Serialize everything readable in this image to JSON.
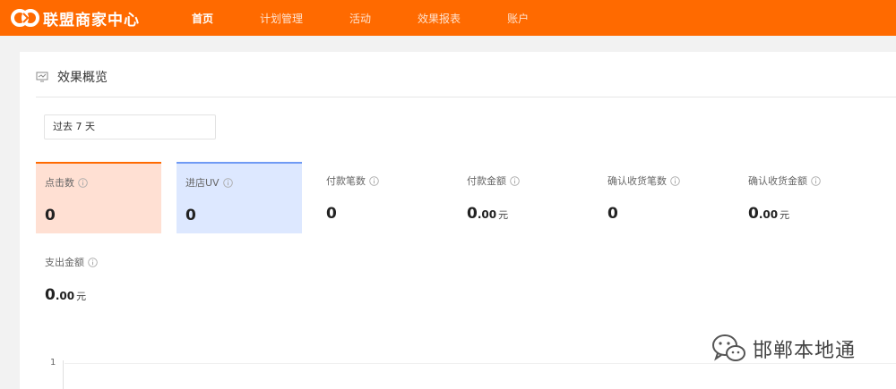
{
  "brand": {
    "name": "联盟商家中心"
  },
  "nav": [
    {
      "label": "首页",
      "active": true
    },
    {
      "label": "计划管理",
      "active": false
    },
    {
      "label": "活动",
      "active": false
    },
    {
      "label": "效果报表",
      "active": false
    },
    {
      "label": "账户",
      "active": false
    }
  ],
  "section": {
    "title": "效果概览"
  },
  "date_range": {
    "value": "过去 7 天"
  },
  "metrics": [
    {
      "label": "点击数",
      "value": "0"
    },
    {
      "label": "进店UV",
      "value": "0"
    },
    {
      "label": "付款笔数",
      "value": "0"
    },
    {
      "label": "付款金额",
      "int": "0",
      "dec": ".00",
      "unit": "元"
    },
    {
      "label": "确认收货笔数",
      "value": "0"
    },
    {
      "label": "确认收货金额",
      "int": "0",
      "dec": ".00",
      "unit": "元"
    },
    {
      "label": "支出金额",
      "int": "0",
      "dec": ".00",
      "unit": "元"
    }
  ],
  "chart": {
    "y_tick": "1"
  },
  "watermark": {
    "text": "邯郸本地通"
  },
  "colors": {
    "brand": "#ff6a00",
    "tile_orange": "#ffe0d3",
    "tile_blue": "#dde8ff"
  }
}
